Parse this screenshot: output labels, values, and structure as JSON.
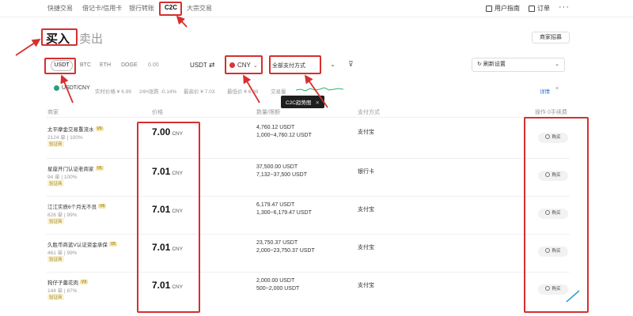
{
  "nav": {
    "tabs": [
      "快捷交易",
      "借记卡/信用卡",
      "银行转账",
      "C2C",
      "大宗交易"
    ],
    "guide": "用户指南",
    "orders": "订单"
  },
  "trade": {
    "buy": "买入",
    "sell": "卖出",
    "ad_button": "商家招募"
  },
  "filters": {
    "coins": [
      "USDT",
      "BTC",
      "ETH",
      "DOGE"
    ],
    "amount_value": "0.00",
    "amount_unit": "USDT",
    "fiat": "CNY",
    "payment": "全部支付方式",
    "refresh": "刷新设置"
  },
  "ticker": {
    "pair": "USDT/CNY",
    "items": [
      "实时价格 ¥ 6.99",
      "24H涨跌 -0.14%",
      "最高价 ¥ 7.03",
      "最低价 ¥ 6.98",
      "交易量"
    ],
    "tooltip": "C2C趋势图",
    "detail": "详情"
  },
  "table": {
    "headers": [
      "商家",
      "价格",
      "数量/限额",
      "支付方式",
      "操作 0手续费"
    ],
    "buy_label": "购买",
    "rows": [
      {
        "name": "太平摩金交易重流水",
        "stats": "2124 单 | 100%",
        "tag": "验证商",
        "price": "7.00",
        "unit": "CNY",
        "qty": "4,760.12 USDT",
        "limit": "1,000~4,760.12 USDT",
        "pay": "支付宝"
      },
      {
        "name": "星座开门认证老商家",
        "stats": "94 单 | 100%",
        "tag": "验证商",
        "price": "7.01",
        "unit": "CNY",
        "qty": "37,500.00 USDT",
        "limit": "7,132~37,500 USDT",
        "pay": "银行卡"
      },
      {
        "name": "江江实质6个月无不良",
        "stats": "826 单 | 99%",
        "tag": "验证商",
        "price": "7.01",
        "unit": "CNY",
        "qty": "6,179.47 USDT",
        "limit": "1,300~6,179.47 USDT",
        "pay": "支付宝"
      },
      {
        "name": "久胜币商蓝V认证资金承保",
        "stats": "461 单 | 99%",
        "tag": "验证商",
        "price": "7.01",
        "unit": "CNY",
        "qty": "23,750.37 USDT",
        "limit": "2,000~23,750.37 USDT",
        "pay": "支付宝"
      },
      {
        "name": "狗仔子羹花肉",
        "stats": "144 单 | 87%",
        "tag": "验证商",
        "price": "7.01",
        "unit": "CNY",
        "qty": "2,000.00 USDT",
        "limit": "500~2,000 USDT",
        "pay": "支付宝"
      }
    ]
  },
  "colors": {
    "annotation": "#d62f2f",
    "link": "#2b6fd6"
  }
}
